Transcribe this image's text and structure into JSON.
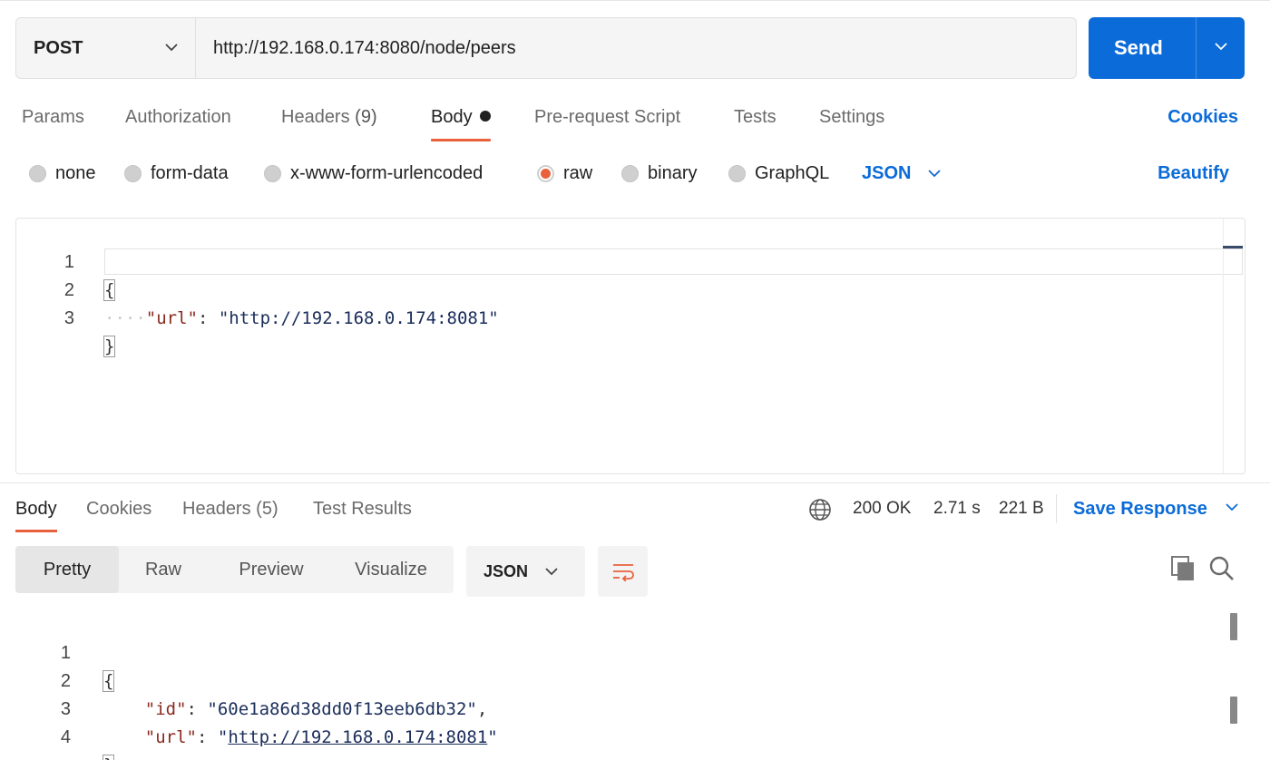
{
  "request": {
    "method": "POST",
    "url": "http://192.168.0.174:8080/node/peers",
    "send_label": "Send"
  },
  "request_tabs": {
    "params": "Params",
    "authorization": "Authorization",
    "headers": "Headers",
    "headers_count": "(9)",
    "body": "Body",
    "pre_request": "Pre-request Script",
    "tests": "Tests",
    "settings": "Settings",
    "cookies": "Cookies"
  },
  "body_types": {
    "none": "none",
    "form_data": "form-data",
    "urlencoded": "x-www-form-urlencoded",
    "raw": "raw",
    "binary": "binary",
    "graphql": "GraphQL",
    "selected": "raw",
    "language": "JSON",
    "beautify": "Beautify"
  },
  "request_body": {
    "lines": [
      {
        "num": "1",
        "open": "{"
      },
      {
        "num": "2",
        "key": "\"url\"",
        "colon": ": ",
        "value": "\"http://192.168.0.174:8081\""
      },
      {
        "num": "3",
        "close": "}"
      }
    ]
  },
  "response_tabs": {
    "body": "Body",
    "cookies": "Cookies",
    "headers": "Headers",
    "headers_count": "(5)",
    "test_results": "Test Results"
  },
  "response_meta": {
    "status": "200 OK",
    "time": "2.71 s",
    "size": "221 B",
    "save_response": "Save Response"
  },
  "response_view": {
    "pretty": "Pretty",
    "raw": "Raw",
    "preview": "Preview",
    "visualize": "Visualize",
    "format": "JSON"
  },
  "response_body": {
    "l1_num": "1",
    "l1": "{",
    "l2_num": "2",
    "l2_key": "\"id\"",
    "l2_colon": ": ",
    "l2_value": "\"60e1a86d38dd0f13eeb6db32\"",
    "l2_comma": ",",
    "l3_num": "3",
    "l3_key": "\"url\"",
    "l3_colon": ": ",
    "l3_q1": "\"",
    "l3_link": "http://192.168.0.174:8081",
    "l3_q2": "\"",
    "l4_num": "4",
    "l4": "}"
  },
  "colors": {
    "accent_blue": "#0b6bd8",
    "tab_indicator": "#e8613c",
    "json_key": "#8b2a1f",
    "json_string": "#1a2d5a"
  },
  "icons": {
    "method_dropdown": "chevron-down-icon",
    "send_dropdown": "chevron-down-icon",
    "language_dropdown": "chevron-down-icon",
    "network": "globe-icon",
    "wrap": "wrap-lines-icon",
    "copy": "copy-icon",
    "search": "search-icon"
  }
}
